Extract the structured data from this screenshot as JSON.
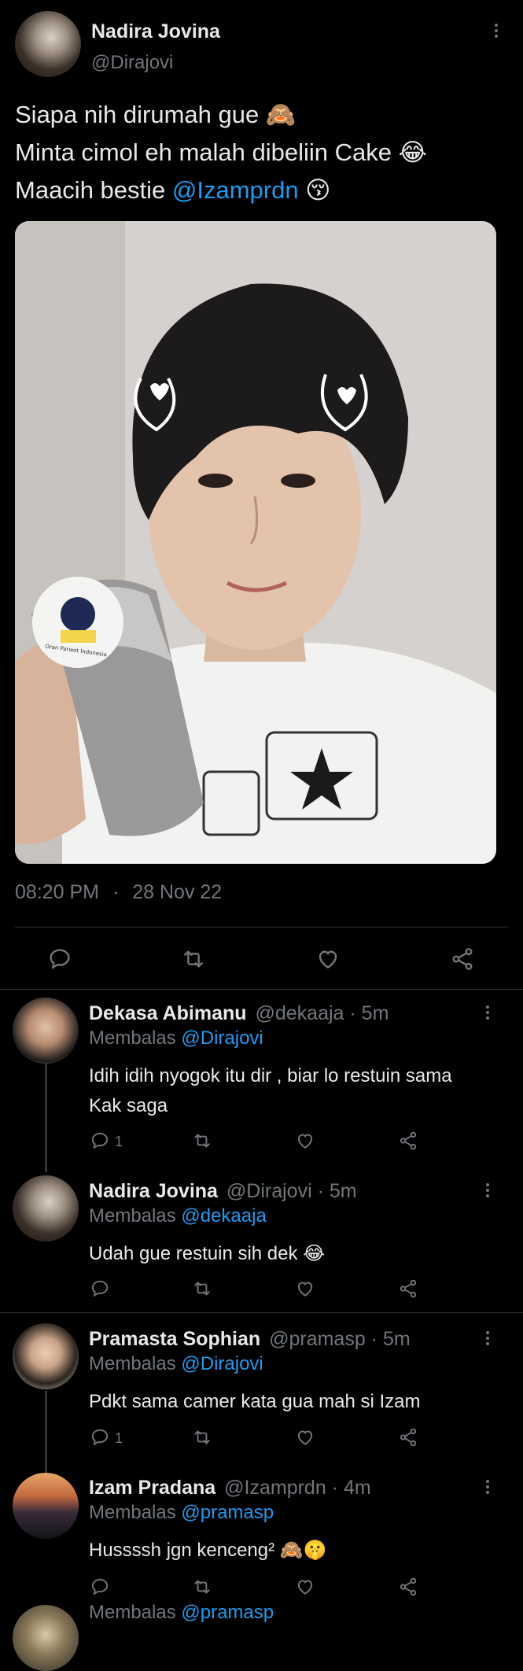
{
  "main_tweet": {
    "author_name": "Nadira Jovina",
    "author_handle": "@Dirajovi",
    "line1_text": "Siapa nih dirumah gue",
    "line1_emoji": "🙈",
    "line2_text": "Minta cimol eh malah dibeliin Cake",
    "line2_emoji": "😂",
    "line3_text": "Maacih bestie ",
    "line3_mention": "@Izamprdn",
    "line3_emoji": "😚",
    "time": "08:20 PM",
    "separator": "·",
    "date": "28 Nov 22",
    "photo_label": "Oran Parwot Indonesia"
  },
  "replies": [
    {
      "name": "Dekasa Abimanu",
      "meta": "@dekaaja · 5m",
      "reply_prefix": "Membalas ",
      "reply_to": "@Dirajovi",
      "text_line1": "Idih idih nyogok itu dir , biar lo restuin sama",
      "text_line2": "Kak saga",
      "emoji": "",
      "reply_count": "1"
    },
    {
      "name": "Nadira Jovina",
      "meta": "@Dirajovi · 5m",
      "reply_prefix": "Membalas ",
      "reply_to": "@dekaaja",
      "text_line1": "Udah gue restuin sih dek ",
      "text_line2": "",
      "emoji": "😂",
      "reply_count": ""
    },
    {
      "name": "Pramasta Sophian",
      "meta": "@pramasp · 5m",
      "reply_prefix": "Membalas ",
      "reply_to": "@Dirajovi",
      "text_line1": "Pdkt sama camer kata gua mah si Izam",
      "text_line2": "",
      "emoji": "",
      "reply_count": "1"
    },
    {
      "name": "Izam Pradana",
      "meta": "@Izamprdn · 4m",
      "reply_prefix": "Membalas ",
      "reply_to": "@pramasp",
      "text_line1": "Hussssh jgn kenceng² ",
      "text_line2": "",
      "emoji": "🙈🤫",
      "reply_count": ""
    }
  ],
  "partial_row": {
    "prefix": "Membalas ",
    "mention": "@pramasp"
  },
  "colors": {
    "background": "#000000",
    "text": "#e7e9ea",
    "muted": "#71767b",
    "link": "#1d9bf0",
    "divider": "#2f3336"
  },
  "icons": [
    "reply-icon",
    "retweet-icon",
    "like-icon",
    "share-icon",
    "more-icon"
  ]
}
